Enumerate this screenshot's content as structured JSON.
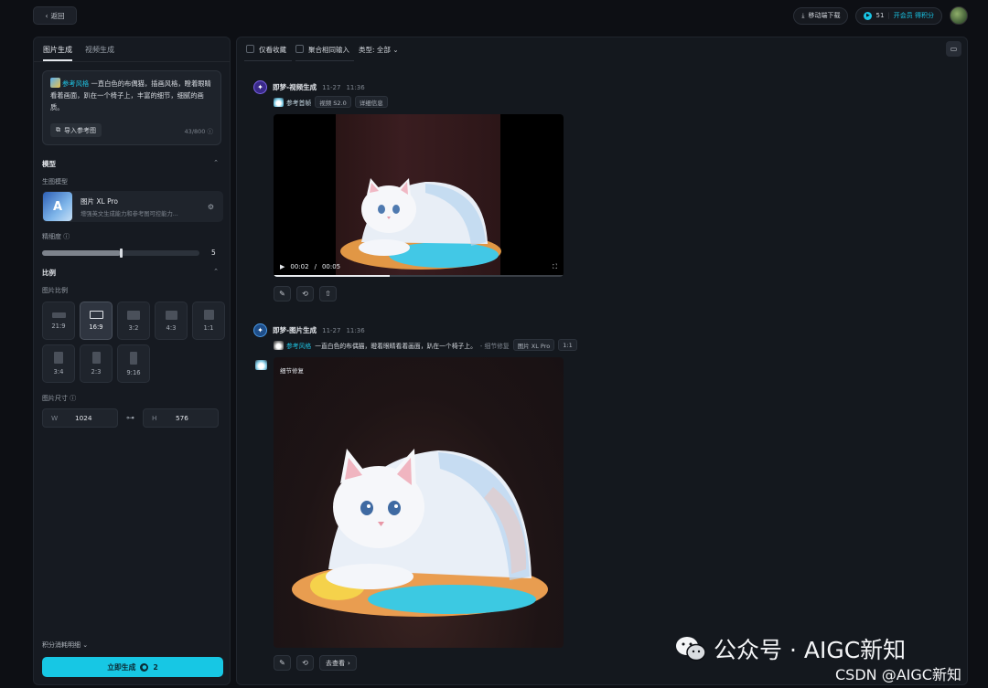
{
  "topbar": {
    "back_label": "返回",
    "mobile_download": "移动端下载",
    "points": "51",
    "vip_label": "开会员 得积分"
  },
  "left": {
    "tabs": [
      "图片生成",
      "视频生成"
    ],
    "active_tab": "图片生成",
    "prompt": {
      "tag": "参考风格",
      "text": "一直白色的布偶猫，插画风格，瞪着眼睛看着画面，趴在一个椅子上，丰富的细节，细腻的画质。",
      "import_label": "导入参考图",
      "counter": "43/800"
    },
    "model_section": "模型",
    "model_sub": "生图模型",
    "model": {
      "name": "图片 XL Pro",
      "desc": "增强英文生成能力和参考图可控能力...",
      "thumb_letter": "A"
    },
    "detail_label": "精细度",
    "detail_value": 5,
    "detail_fraction": 0.5,
    "ratio_section": "比例",
    "ratio_sub": "图片比例",
    "ratios": [
      "21:9",
      "16:9",
      "3:2",
      "4:3",
      "1:1",
      "3:4",
      "2:3",
      "9:16"
    ],
    "active_ratio": "16:9",
    "size_label": "图片尺寸",
    "width_label": "W",
    "width": "1024",
    "height_label": "H",
    "height": "576",
    "cost_label": "积分消耗明细",
    "generate_label": "立即生成",
    "generate_cost": "2"
  },
  "main": {
    "filter_fav": "仅看收藏",
    "filter_merge": "聚合相同输入",
    "filter_type": "类型: 全部",
    "entries": [
      {
        "title": "即梦-视频生成",
        "date": "11-27",
        "time": "11:36",
        "ref_label": "参考首帧",
        "chips": [
          "视频 S2.0",
          "详细信息"
        ],
        "time_current": "00:02",
        "time_total": "00:05",
        "progress": 0.4
      },
      {
        "title": "即梦-图片生成",
        "date": "11-27",
        "time": "11:36",
        "ref_label": "参考风格",
        "prompt": "一直白色的布偶猫，瞪着眼睛看着画面，趴在一个椅子上。",
        "suffix": "- 细节修复",
        "chips": [
          "图片 XL Pro",
          "1:1"
        ],
        "badge": "细节修复",
        "more_label": "去查看"
      }
    ]
  },
  "watermark": {
    "text": "公众号 · AIGC新知",
    "csdn": "CSDN @AIGC新知"
  }
}
